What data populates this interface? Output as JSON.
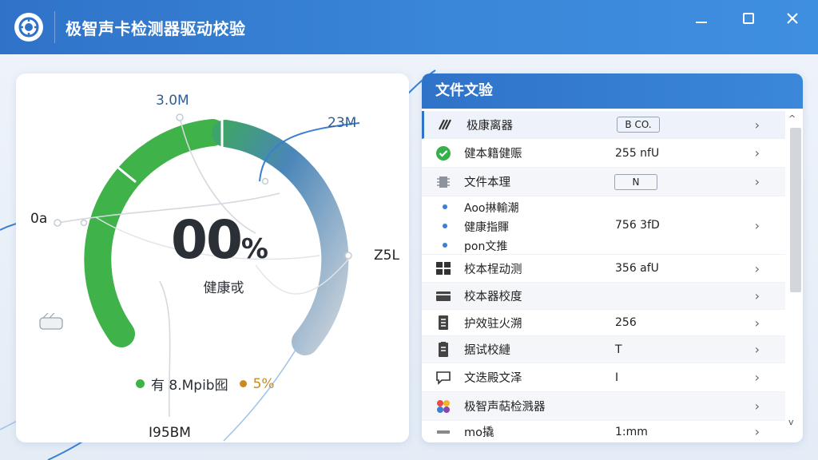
{
  "window": {
    "title": "极智声卡检测器驱动校验",
    "minimize": "—",
    "close": "✕"
  },
  "gauge": {
    "value": "00",
    "percent_sign": "%",
    "caption": "健康戓",
    "legend_text": "有 8.Mpib囮",
    "legend_pct": "5%",
    "labels": {
      "top": "3.0M",
      "top_right": "23M",
      "left": "0a",
      "right": "Z5L",
      "bottom": "I95BM"
    },
    "colors": {
      "green": "#3fb24a",
      "blue": "#4a86b8",
      "gray": "#c6ccd4"
    }
  },
  "panel": {
    "title": "文件文验",
    "rows": [
      {
        "icon": "waveform-icon",
        "label": "极康离器",
        "pill": "B CO."
      },
      {
        "icon": "shield-check-icon",
        "label": "健本籍健赈",
        "value": "255 nfU"
      },
      {
        "icon": "chip-icon",
        "label": "文件本理",
        "pill": "N"
      },
      {
        "icon": "",
        "subs": [
          "Aoo㨆輸潮",
          "健康指賱",
          "pon文推"
        ],
        "value": "756 3fD"
      },
      {
        "icon": "grid-icon",
        "label": "校本桯动测",
        "value": "356 afU"
      },
      {
        "icon": "card-icon",
        "label": "校本器校度",
        "value": ""
      },
      {
        "icon": "doc-icon",
        "label": "护效驻火溯",
        "value": "256"
      },
      {
        "icon": "doc2-icon",
        "label": "据试校縺",
        "value": "T"
      },
      {
        "icon": "chat-icon",
        "label": "文迭殿文泽",
        "value": "I"
      },
      {
        "icon": "apps-icon",
        "label": "极智声萜检溅器",
        "value": ""
      },
      {
        "icon": "dash-icon",
        "label": "mo撬",
        "value": "1:mm"
      }
    ]
  }
}
